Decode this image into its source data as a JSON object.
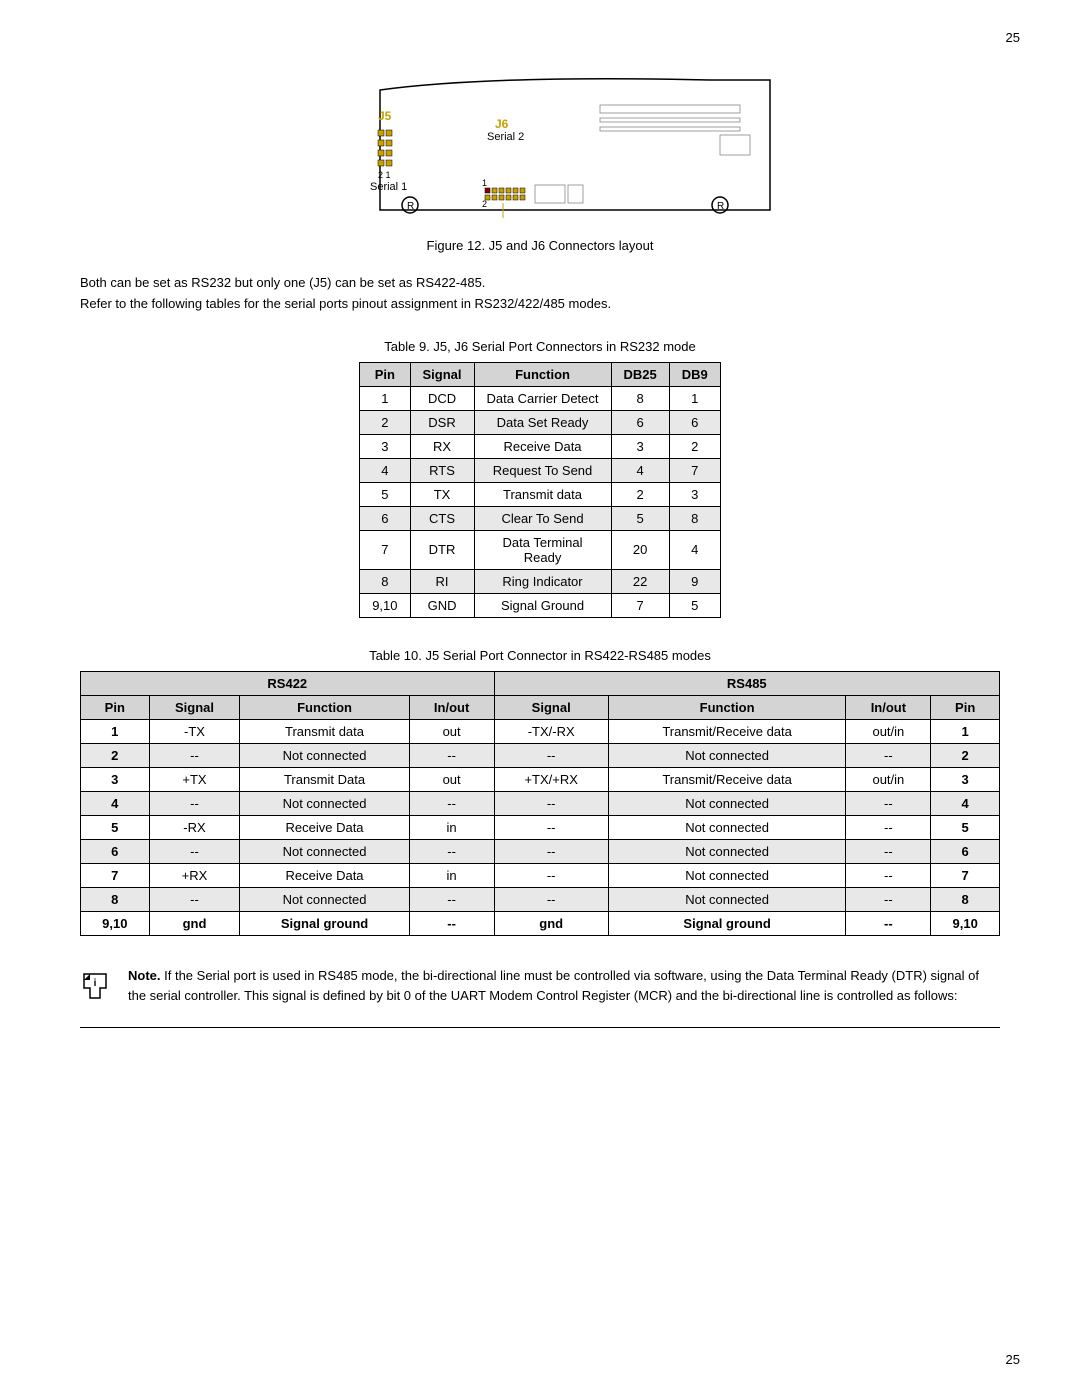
{
  "page": {
    "number_top": "25",
    "number_bottom": "25"
  },
  "figure": {
    "caption": "Figure 12.     J5 and J6 Connectors layout",
    "j5_label": "J5",
    "j5_sublabel": "Serial 1",
    "j6_label": "J6",
    "j6_sublabel": "Serial 2"
  },
  "intro": {
    "line1": "Both can be set as RS232 but only one (J5) can be set as RS422-485.",
    "line2": "Refer to the following tables for the serial ports pinout assignment in RS232/422/485 modes."
  },
  "table9": {
    "caption": "Table 9.     J5, J6 Serial Port Connectors in RS232 mode",
    "headers": [
      "Pin",
      "Signal",
      "Function",
      "DB25",
      "DB9"
    ],
    "rows": [
      [
        "1",
        "DCD",
        "Data Carrier Detect",
        "8",
        "1"
      ],
      [
        "2",
        "DSR",
        "Data Set Ready",
        "6",
        "6"
      ],
      [
        "3",
        "RX",
        "Receive Data",
        "3",
        "2"
      ],
      [
        "4",
        "RTS",
        "Request To Send",
        "4",
        "7"
      ],
      [
        "5",
        "TX",
        "Transmit data",
        "2",
        "3"
      ],
      [
        "6",
        "CTS",
        "Clear To Send",
        "5",
        "8"
      ],
      [
        "7",
        "DTR",
        "Data Terminal\nReady",
        "20",
        "4"
      ],
      [
        "8",
        "RI",
        "Ring Indicator",
        "22",
        "9"
      ],
      [
        "9,10",
        "GND",
        "Signal Ground",
        "7",
        "5"
      ]
    ]
  },
  "table10": {
    "caption": "Table 10.     J5 Serial Port Connector in RS422-RS485 modes",
    "rs422_header": "RS422",
    "rs485_header": "RS485",
    "subheaders_left": [
      "Pin",
      "Signal",
      "Function",
      "In/out"
    ],
    "subheaders_right": [
      "Signal",
      "Function",
      "In/out",
      "Pin"
    ],
    "rows": [
      {
        "pin_l": "1",
        "signal_l": "-TX",
        "function_l": "Transmit data",
        "inout_l": "out",
        "signal_r": "-TX/-RX",
        "function_r": "Transmit/Receive data",
        "inout_r": "out/in",
        "pin_r": "1"
      },
      {
        "pin_l": "2",
        "signal_l": "--",
        "function_l": "Not connected",
        "inout_l": "--",
        "signal_r": "--",
        "function_r": "Not connected",
        "inout_r": "--",
        "pin_r": "2"
      },
      {
        "pin_l": "3",
        "signal_l": "+TX",
        "function_l": "Transmit Data",
        "inout_l": "out",
        "signal_r": "+TX/+RX",
        "function_r": "Transmit/Receive data",
        "inout_r": "out/in",
        "pin_r": "3"
      },
      {
        "pin_l": "4",
        "signal_l": "--",
        "function_l": "Not connected",
        "inout_l": "--",
        "signal_r": "--",
        "function_r": "Not connected",
        "inout_r": "--",
        "pin_r": "4"
      },
      {
        "pin_l": "5",
        "signal_l": "-RX",
        "function_l": "Receive Data",
        "inout_l": "in",
        "signal_r": "--",
        "function_r": "Not connected",
        "inout_r": "--",
        "pin_r": "5"
      },
      {
        "pin_l": "6",
        "signal_l": "--",
        "function_l": "Not connected",
        "inout_l": "--",
        "signal_r": "--",
        "function_r": "Not connected",
        "inout_r": "--",
        "pin_r": "6"
      },
      {
        "pin_l": "7",
        "signal_l": "+RX",
        "function_l": "Receive Data",
        "inout_l": "in",
        "signal_r": "--",
        "function_r": "Not connected",
        "inout_r": "--",
        "pin_r": "7"
      },
      {
        "pin_l": "8",
        "signal_l": "--",
        "function_l": "Not connected",
        "inout_l": "--",
        "signal_r": "--",
        "function_r": "Not connected",
        "inout_r": "--",
        "pin_r": "8"
      },
      {
        "pin_l": "9,10",
        "signal_l": "gnd",
        "function_l": "Signal ground",
        "inout_l": "--",
        "signal_r": "gnd",
        "function_r": "Signal ground",
        "inout_r": "--",
        "pin_r": "9,10"
      }
    ]
  },
  "note": {
    "label": "Note.",
    "text": "If the Serial port is used in RS485 mode, the bi-directional line must be controlled via software, using the Data Terminal Ready (DTR) signal of the serial controller. This signal is defined by bit 0 of the UART Modem Control Register (MCR) and the bi-directional line is controlled as follows:"
  }
}
